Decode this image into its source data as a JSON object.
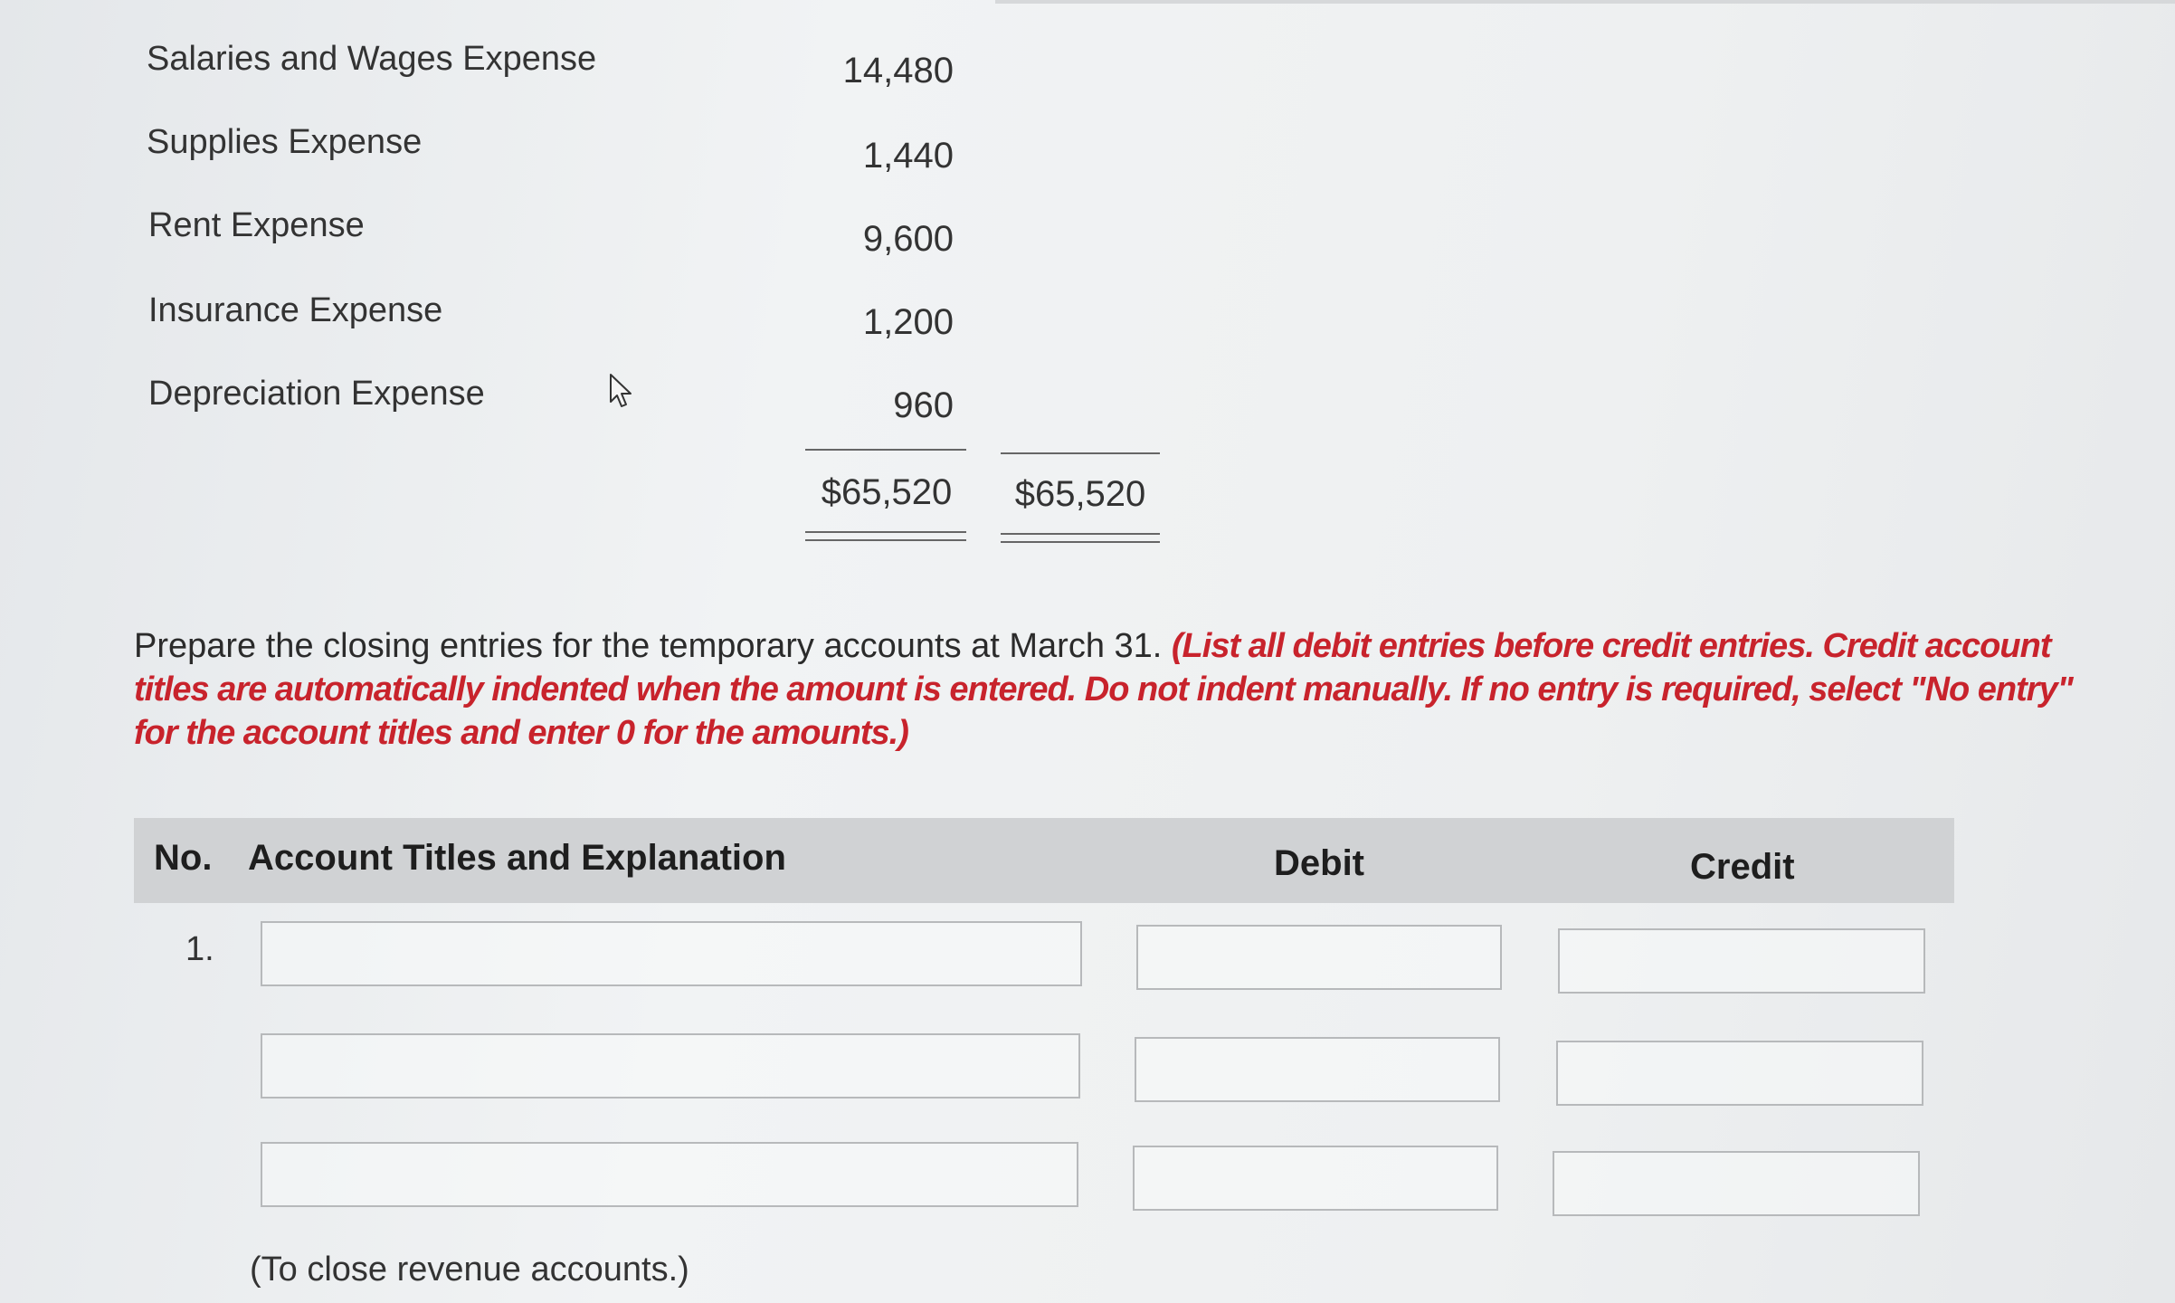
{
  "accounts": [
    {
      "label": "Salaries and Wages Expense",
      "amount": "14,480"
    },
    {
      "label": "Supplies Expense",
      "amount": "1,440"
    },
    {
      "label": "Rent Expense",
      "amount": "9,600"
    },
    {
      "label": "Insurance Expense",
      "amount": "1,200"
    },
    {
      "label": "Depreciation Expense",
      "amount": "960"
    }
  ],
  "totals": {
    "debit": "$65,520",
    "credit": "$65,520"
  },
  "instructions": {
    "main": "Prepare the closing entries for the temporary accounts at March 31. ",
    "note": "(List all debit entries before credit entries. Credit account titles are automatically indented when the amount is entered. Do not indent manually. If no entry is required, select \"No entry\" for the account titles and enter 0 for the amounts.)"
  },
  "table": {
    "headers": {
      "no": "No.",
      "account": "Account Titles and Explanation",
      "debit": "Debit",
      "credit": "Credit"
    },
    "entry_number": "1.",
    "explanation": "(To close revenue accounts.)"
  },
  "colors": {
    "instruction_red": "#c8232c",
    "header_bg": "#d0d2d4"
  },
  "icons": {
    "cursor": "arrow-cursor-icon"
  }
}
